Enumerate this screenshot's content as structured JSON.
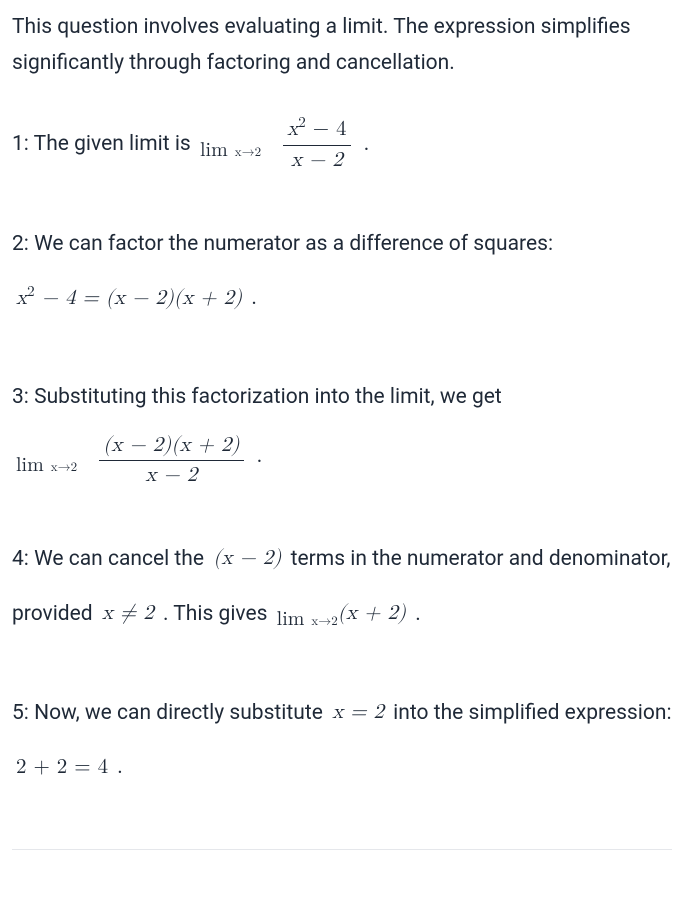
{
  "intro": "This question involves evaluating a limit. The expression simplifies significantly through factoring and cancellation.",
  "steps": {
    "s1a": "1: The given limit is ",
    "s1_lim_num": "x",
    "s1_lim_sup": "2",
    "s1_lim_minus4": " − 4",
    "s1_lim_den": "x − 2",
    "s1_period": " .",
    "s2a": "2: We can factor the numerator as a difference of squares: ",
    "s2_lhs_x": "x",
    "s2_lhs_sup": "2",
    "s2_lhs_rest": " − 4 = (x − 2)(x + 2)",
    "s2_period": " .",
    "s3a": "3: Substituting this factorization into the limit, we get ",
    "s3_num": "(x − 2)(x + 2)",
    "s3_den": "x − 2",
    "s3_period": " .",
    "s4a": "4: We can cancel the ",
    "s4_term": "(x − 2)",
    "s4b": " terms in the numerator and denominator, provided ",
    "s4_cond": "x ≠ 2",
    "s4c": " . This gives ",
    "s4_result": "(x + 2)",
    "s4_period": " .",
    "s5a": "5: Now, we can directly substitute ",
    "s5_sub": "x = 2",
    "s5b": " into the simplified expression: ",
    "s5_eq": "2 + 2 = 4",
    "s5_period": " ."
  },
  "lim": {
    "top": "lim",
    "bot": "x→2"
  }
}
